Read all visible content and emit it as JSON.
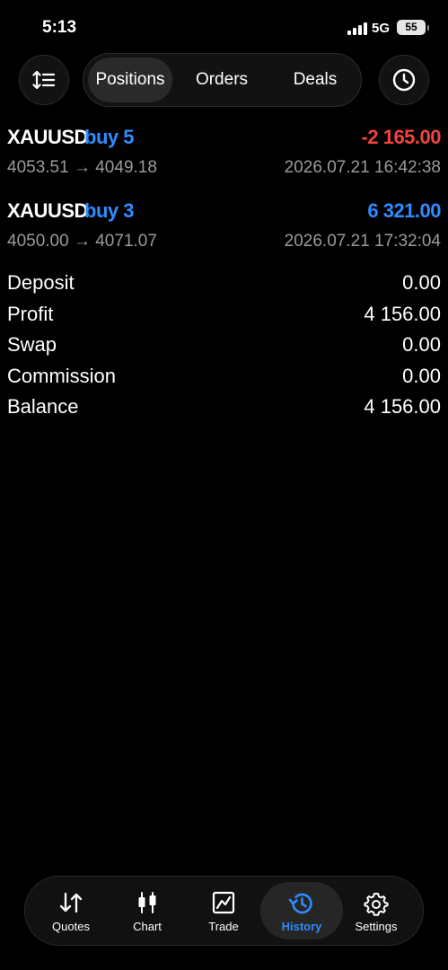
{
  "status": {
    "time": "5:13",
    "network": "5G",
    "battery": "55"
  },
  "segments": {
    "positions": "Positions",
    "orders": "Orders",
    "deals": "Deals"
  },
  "deals": [
    {
      "symbol": "XAUUSD",
      "side": "buy 5",
      "profit": "-2 165.00",
      "prices": "4053.51 → 4049.18",
      "datetime": "2026.07.21 16:42:38"
    },
    {
      "symbol": "XAUUSD",
      "side": "buy 3",
      "profit": "6 321.00",
      "prices": "4050.00 → 4071.07",
      "datetime": "2026.07.21 17:32:04"
    }
  ],
  "summary": [
    {
      "label": "Deposit",
      "value": "0.00"
    },
    {
      "label": "Profit",
      "value": "4 156.00"
    },
    {
      "label": "Swap",
      "value": "0.00"
    },
    {
      "label": "Commission",
      "value": "0.00"
    },
    {
      "label": "Balance",
      "value": "4 156.00"
    }
  ],
  "tabbar": {
    "quotes": "Quotes",
    "chart": "Chart",
    "trade": "Trade",
    "history": "History",
    "settings": "Settings"
  },
  "colors": {
    "loss": "#f0443c",
    "gain": "#2f8cff",
    "accent": "#2f8cff",
    "muted": "#9a9a9a"
  }
}
